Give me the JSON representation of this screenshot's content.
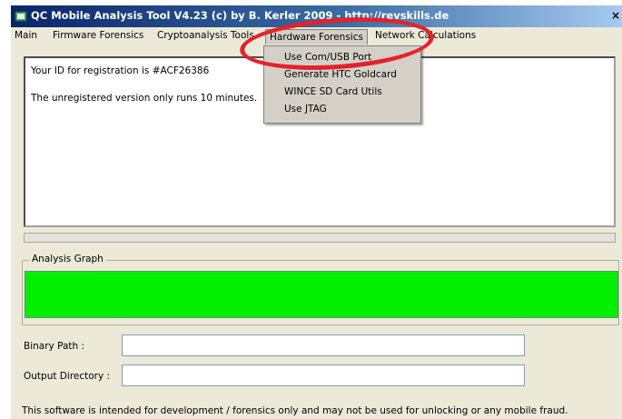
{
  "window": {
    "title": "QC Mobile Analysis Tool V4.23 (c) by B. Kerler 2009 - http://revskills.de",
    "close_glyph": "×"
  },
  "menu": {
    "items": [
      {
        "label": "Main"
      },
      {
        "label": "Firmware Forensics"
      },
      {
        "label": "Cryptoanalysis Tools"
      },
      {
        "label": "Hardware Forensics"
      },
      {
        "label": "Network Calculations"
      }
    ],
    "open_menu": "Hardware Forensics",
    "dropdown": [
      {
        "label": "Use Com/USB Port"
      },
      {
        "label": "Generate HTC Goldcard"
      },
      {
        "label": "WINCE SD Card Utils"
      },
      {
        "label": "Use JTAG"
      }
    ]
  },
  "output": {
    "lines": [
      "Your ID for registration is #ACF26386",
      "The unregistered version only runs 10 minutes."
    ]
  },
  "progress": {
    "value": 0
  },
  "analysis": {
    "group_label": "Analysis Graph",
    "graph_color": "#00f000"
  },
  "fields": {
    "binary_path_label": "Binary Path :",
    "binary_path_value": "",
    "output_dir_label": "Output Directory :",
    "output_dir_value": ""
  },
  "footer": {
    "text": "This software is intended for development / forensics only and may not be used for unlocking or any mobile fraud."
  },
  "colors": {
    "titlebar": "#0a246a",
    "annotation": "#e3222a",
    "window_bg": "#ece9d8"
  }
}
